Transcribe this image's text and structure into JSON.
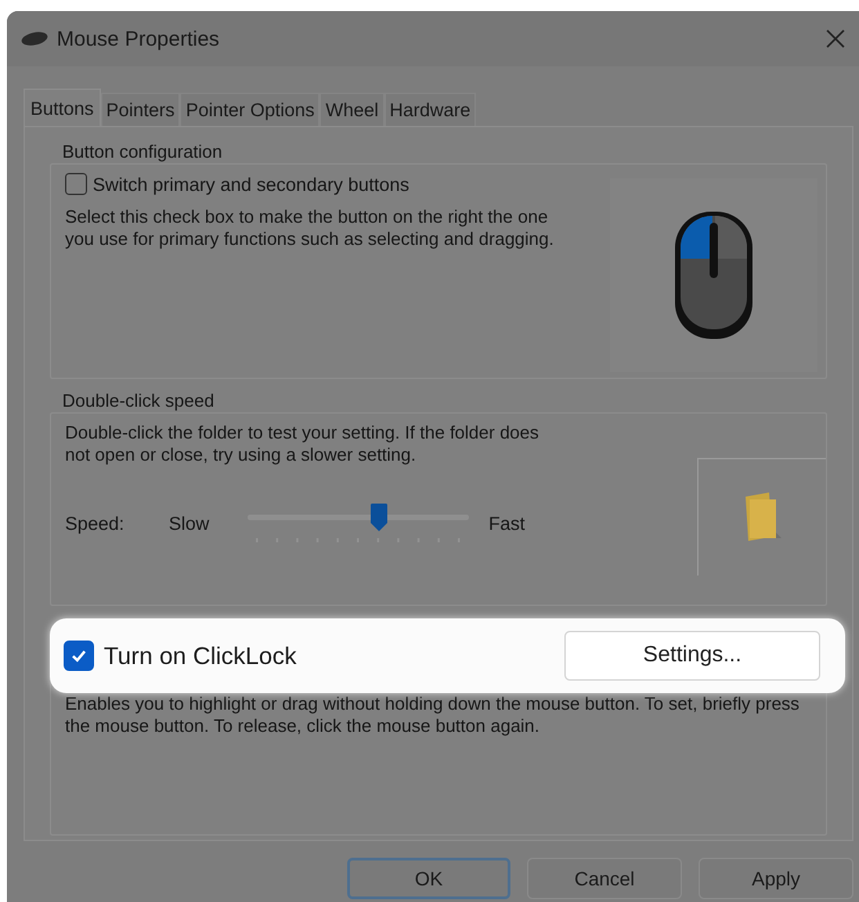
{
  "window": {
    "title": "Mouse Properties"
  },
  "tabs": [
    {
      "label": "Buttons",
      "selected": true
    },
    {
      "label": "Pointers",
      "selected": false
    },
    {
      "label": "Pointer Options",
      "selected": false
    },
    {
      "label": "Wheel",
      "selected": false
    },
    {
      "label": "Hardware",
      "selected": false
    }
  ],
  "button_configuration": {
    "title": "Button configuration",
    "checkbox": {
      "label": "Switch primary and secondary buttons",
      "checked": false
    },
    "description": "Select this check box to make the button on the right the one you use for primary functions such as selecting and dragging."
  },
  "double_click_speed": {
    "title": "Double-click speed",
    "description": "Double-click the folder to test your setting. If the folder does not open or close, try using a slower setting.",
    "speed_label": "Speed:",
    "slow_label": "Slow",
    "fast_label": "Fast",
    "slider": {
      "level": 0.59
    }
  },
  "clicklock": {
    "checkbox": {
      "label": "Turn on ClickLock",
      "checked": true
    },
    "settings_button": "Settings...",
    "description": "Enables you to highlight or drag without holding down the mouse button. To set, briefly press the mouse button. To release, click the mouse button again."
  },
  "buttons": [
    {
      "label": "OK",
      "kind": "default"
    },
    {
      "label": "Cancel",
      "kind": "normal"
    },
    {
      "label": "Apply",
      "kind": "normal"
    }
  ]
}
